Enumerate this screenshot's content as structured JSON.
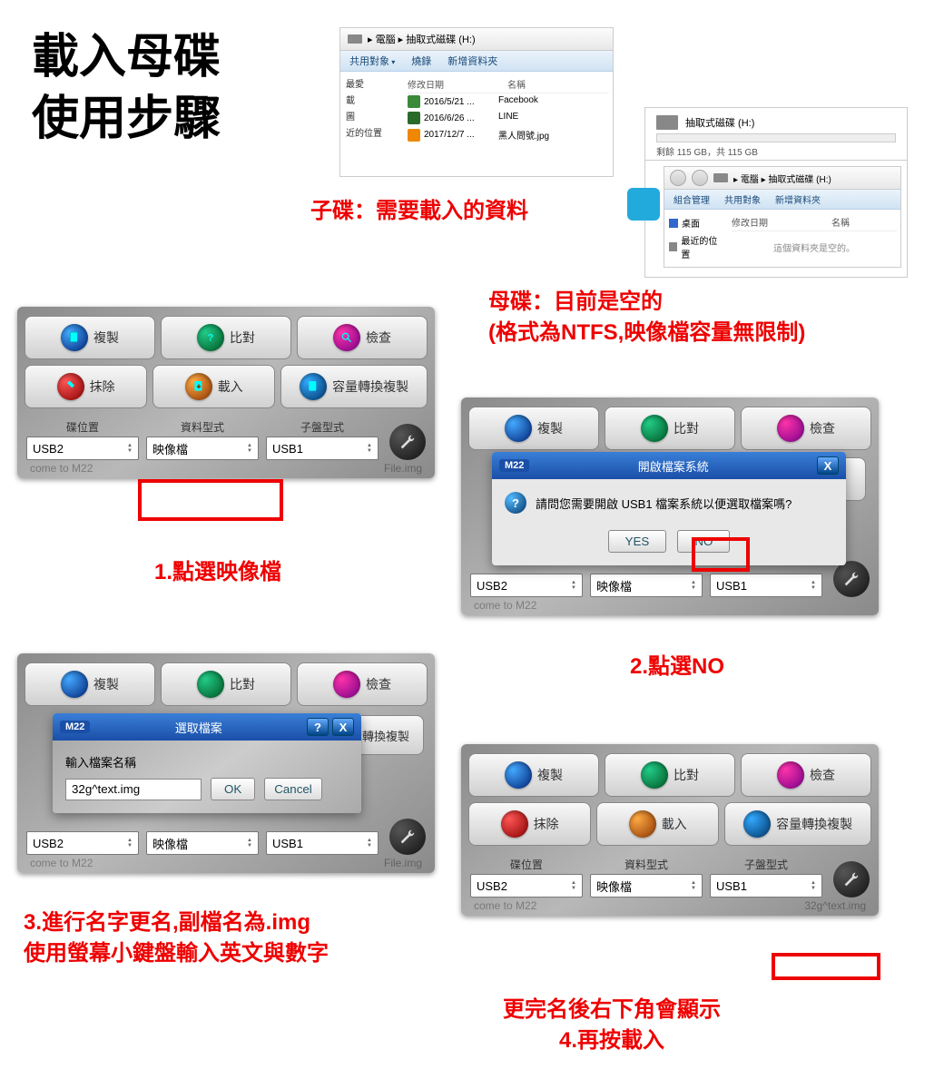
{
  "title_line1": "載入母碟",
  "title_line2": "使用步驟",
  "explorer1": {
    "addr_parent": "電腦",
    "addr_current": "抽取式磁碟 (H:)",
    "toolbar": {
      "share": "共用對象",
      "burn": "燒錄",
      "new_folder": "新增資料夾"
    },
    "sidebar": {
      "fav": "最愛",
      "down": "載",
      "pic": "圖",
      "recent": "近的位置"
    },
    "cols": {
      "date": "修改日期",
      "name": "名稱"
    },
    "rows": [
      {
        "date": "2016/5/21 ...",
        "name": "Facebook"
      },
      {
        "date": "2016/6/26 ...",
        "name": "LINE"
      },
      {
        "date": "2017/12/7 ...",
        "name": "黑人問號.jpg"
      }
    ]
  },
  "caption1": "子碟：需要載入的資料",
  "explorer2": {
    "drive_name": "抽取式磁碟 (H:)",
    "drive_info": "剩餘 115 GB，共 115 GB",
    "addr_parent": "電腦",
    "addr_current": "抽取式磁碟 (H:)",
    "toolbar": {
      "org": "組合管理",
      "share": "共用對象",
      "new_folder": "新增資料夾"
    },
    "sidebar": {
      "desktop": "桌面",
      "recent": "最近的位置"
    },
    "cols": {
      "date": "修改日期",
      "name": "名稱"
    },
    "empty_msg": "這個資料夾是空的。"
  },
  "caption2_line1": "母碟：目前是空的",
  "caption2_line2": "(格式為NTFS,映像檔容量無限制)",
  "m22": {
    "btns": {
      "copy": "複製",
      "compare": "比對",
      "check": "檢查",
      "erase": "抹除",
      "load": "載入",
      "convert": "容量轉換複製"
    },
    "labels": {
      "disk_pos": "碟位置",
      "data_format": "資料型式",
      "sub_format": "子盤型式"
    },
    "selects": {
      "usb2": "USB2",
      "image": "映像檔",
      "usb1": "USB1"
    },
    "welcome": "come to M22",
    "imgfile": "32g^text.img",
    "file_placeholder": "File.img"
  },
  "step1": "1.點選映像檔",
  "step2": "2.點選NO",
  "step3_line1": "3.進行名字更名,副檔名為.img",
  "step3_line2": "使用螢幕小鍵盤輸入英文與數字",
  "step4_line1": "更完名後右下角會顯示",
  "step4_line2": "4.再按載入",
  "dialog1": {
    "tag": "M22",
    "title": "開啟檔案系統",
    "msg": "請問您需要開啟 USB1 檔案系統以便選取檔案嗎?",
    "yes": "YES",
    "no": "NO"
  },
  "dialog2": {
    "tag": "M22",
    "title": "選取檔案",
    "label": "輸入檔案名稱",
    "value": "32g^text.img",
    "ok": "OK",
    "cancel": "Cancel"
  }
}
